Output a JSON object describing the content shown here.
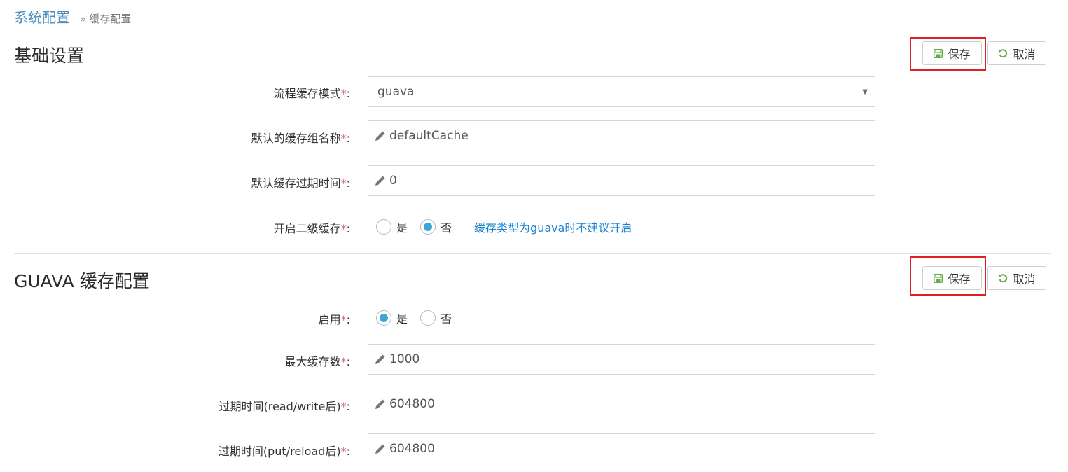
{
  "breadcrumb": {
    "root": "系统配置",
    "separator": "»",
    "current": "缓存配置"
  },
  "sections": {
    "basic": {
      "title": "基础设置",
      "save_label": "保存",
      "cancel_label": "取消",
      "fields": {
        "cache_mode": {
          "label": "流程缓存模式",
          "value": "guava"
        },
        "group_name": {
          "label": "默认的缓存组名称",
          "value": "defaultCache"
        },
        "expire_time": {
          "label": "默认缓存过期时间",
          "value": "0"
        },
        "second_level": {
          "label": "开启二级缓存",
          "options": [
            "是",
            "否"
          ],
          "selected": "否",
          "hint": "缓存类型为guava时不建议开启"
        }
      }
    },
    "guava": {
      "title": "GUAVA 缓存配置",
      "save_label": "保存",
      "cancel_label": "取消",
      "fields": {
        "enabled": {
          "label": "启用",
          "options": [
            "是",
            "否"
          ],
          "selected": "是"
        },
        "max_size": {
          "label": "最大缓存数",
          "value": "1000"
        },
        "expire_rw": {
          "label": "过期时间(read/write后)",
          "value": "604800"
        },
        "expire_pr": {
          "label": "过期时间(put/reload后)",
          "value": "604800"
        }
      }
    }
  },
  "required_mark": "*",
  "colon": ":",
  "colors": {
    "accent": "#4c8fbd",
    "hint": "#1b82d1",
    "radio_checked": "#3ea5d6",
    "highlight": "#dd1f26",
    "required": "#d16e6c"
  }
}
